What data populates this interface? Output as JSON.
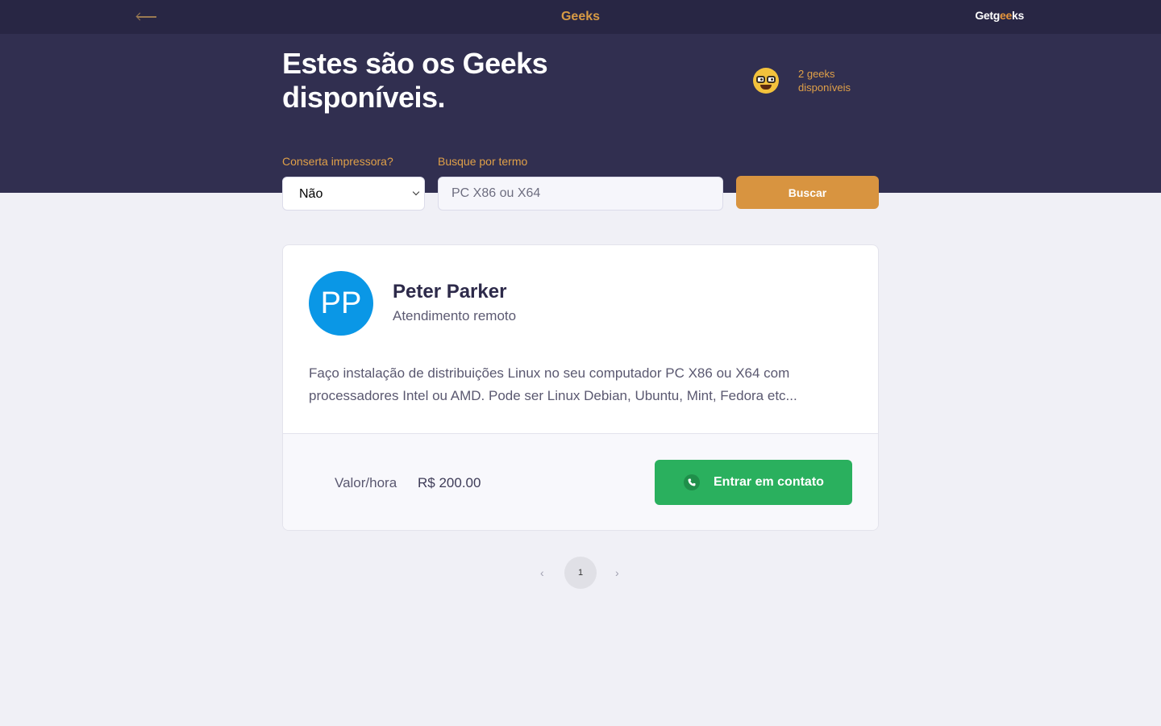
{
  "topbar": {
    "title": "Geeks",
    "logo_prefix": "Getg",
    "logo_highlight": "ee",
    "logo_suffix": "ks",
    "back_icon": "arrow-left-icon"
  },
  "hero": {
    "title": "Estes são os Geeks disponíveis.",
    "count_text": "2 geeks disponíveis",
    "emoji_icon": "nerd-face-icon"
  },
  "filters": {
    "printer_label": "Conserta impressora?",
    "printer_selected": "Não",
    "search_label": "Busque por termo",
    "search_placeholder": "PC X86 ou X64",
    "search_button": "Buscar"
  },
  "geeks": [
    {
      "initials": "PP",
      "name": "Peter Parker",
      "subtitle": "Atendimento remoto",
      "description": "Faço instalação de distribuições Linux no seu computador PC X86 ou X64 com processadores Intel ou AMD. Pode ser Linux Debian, Ubuntu, Mint, Fedora etc...",
      "price_label": "Valor/hora",
      "price_value": "R$ 200.00",
      "contact_label": "Entrar em contato",
      "contact_icon": "whatsapp-icon"
    }
  ],
  "pagination": {
    "prev": "‹",
    "current": "1",
    "next": "›"
  },
  "colors": {
    "topbar_bg": "#282644",
    "hero_bg": "#312f50",
    "accent": "#d89440",
    "contact_green": "#2ab05e",
    "avatar_blue": "#0a97e6"
  }
}
